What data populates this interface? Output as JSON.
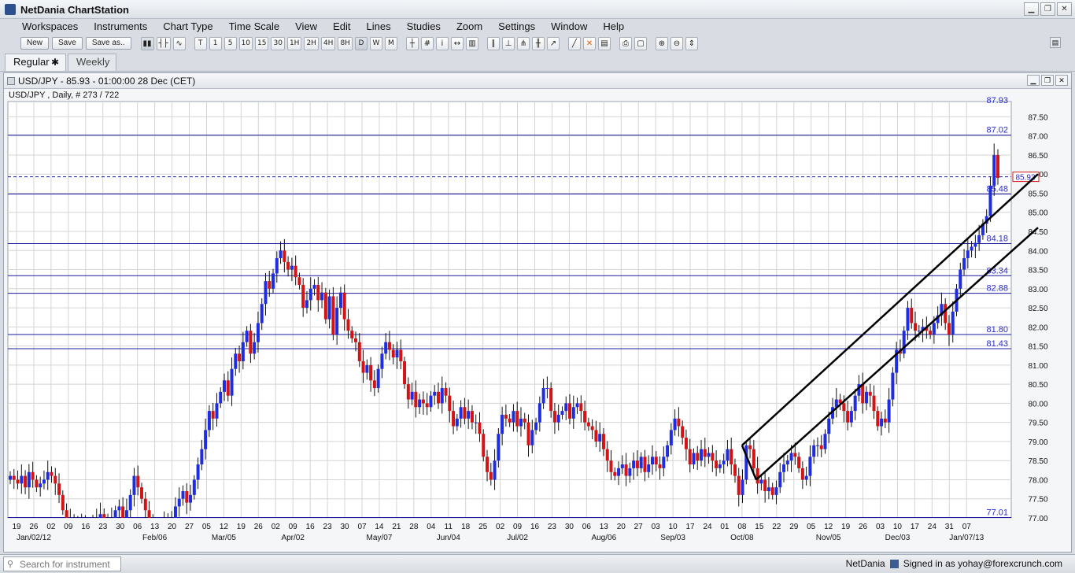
{
  "app": {
    "title": "NetDania ChartStation"
  },
  "menu": [
    "Workspaces",
    "Instruments",
    "Chart Type",
    "Time Scale",
    "View",
    "Edit",
    "Lines",
    "Studies",
    "Zoom",
    "Settings",
    "Window",
    "Help"
  ],
  "toolbar": {
    "new_label": "New",
    "save_label": "Save",
    "save_as_label": "Save as..",
    "timescale_buttons": [
      "T",
      "1",
      "5",
      "10",
      "15",
      "30",
      "1H",
      "2H",
      "4H",
      "8H",
      "D",
      "W",
      "M"
    ],
    "active_timescale": "D"
  },
  "tabs": [
    {
      "label": "Regular",
      "active": true
    },
    {
      "label": "Weekly",
      "active": false
    }
  ],
  "chart_window": {
    "title": "USD/JPY - 85.93 - 01:00:00  28 Dec (CET)",
    "subtitle": "USD/JPY , Daily, # 273 / 722"
  },
  "status": {
    "search_placeholder": "Search for instrument",
    "brand": "NetDania",
    "signed_in": "Signed in as yohay@forexcrunch.com"
  },
  "colors": {
    "up_candle": "#1f2de0",
    "down_candle": "#d21414",
    "hline": "#1a1aa0",
    "grid": "#d4d4d4",
    "price_label": "#2a2acc"
  },
  "chart_data": {
    "type": "candlestick",
    "instrument": "USD/JPY",
    "interval": "Daily",
    "ylim": [
      77.0,
      87.9
    ],
    "y_ticks": [
      77.0,
      77.5,
      78.0,
      78.5,
      79.0,
      79.5,
      80.0,
      80.5,
      81.0,
      81.5,
      82.0,
      82.5,
      83.0,
      83.5,
      84.0,
      84.5,
      85.0,
      85.5,
      86.0,
      86.5,
      87.0,
      87.5
    ],
    "y_tick_labels": [
      "77.00",
      "77.50",
      "78.00",
      "78.50",
      "79.00",
      "79.50",
      "80.00",
      "80.50",
      "81.00",
      "81.50",
      "82.00",
      "82.50",
      "83.00",
      "83.50",
      "84.00",
      "84.50",
      "85.00",
      "85.50",
      "86.00",
      "86.50",
      "87.00",
      "87.50"
    ],
    "x_tick_labels": [
      "19",
      "26",
      "02",
      "09",
      "16",
      "23",
      "30",
      "06",
      "13",
      "20",
      "27",
      "05",
      "12",
      "19",
      "26",
      "02",
      "09",
      "16",
      "23",
      "30",
      "07",
      "14",
      "21",
      "28",
      "04",
      "11",
      "18",
      "25",
      "02",
      "09",
      "16",
      "23",
      "30",
      "06",
      "13",
      "20",
      "27",
      "03",
      "10",
      "17",
      "24",
      "01",
      "08",
      "15",
      "22",
      "29",
      "05",
      "12",
      "19",
      "26",
      "03",
      "10",
      "17",
      "24",
      "31",
      "07"
    ],
    "x_month_labels": [
      "Jan/02/12",
      "Feb/06",
      "Mar/05",
      "Apr/02",
      "May/07",
      "Jun/04",
      "Jul/02",
      "Aug/06",
      "Sep/03",
      "Oct/08",
      "Nov/05",
      "Dec/03",
      "Jan/07/13"
    ],
    "horizontal_levels": [
      87.02,
      85.48,
      84.18,
      83.34,
      82.88,
      81.8,
      81.43,
      77.01
    ],
    "horizontal_level_labels": [
      "87.02",
      "85.48",
      "84.18",
      "83.34",
      "82.88",
      "81.80",
      "81.43",
      "77.01"
    ],
    "top_cut_label": "87.93",
    "last_price": 85.93,
    "last_price_label": "85.93",
    "channel": {
      "upper": [
        {
          "date": "Oct/08",
          "price": 78.9
        },
        {
          "date": "Jan/07/13",
          "price": 86.0
        }
      ],
      "lower": [
        {
          "date": "Oct/12",
          "price": 78.0
        },
        {
          "date": "Jan/07/13",
          "price": 84.6
        }
      ]
    },
    "closes": [
      78.1,
      78.0,
      77.9,
      78.1,
      77.8,
      78.2,
      78.0,
      77.8,
      77.9,
      78.0,
      78.2,
      78.1,
      77.9,
      77.6,
      77.2,
      77.0,
      76.8,
      76.7,
      76.9,
      76.6,
      76.8,
      76.7,
      76.9,
      77.0,
      77.1,
      76.8,
      76.9,
      77.0,
      77.2,
      77.3,
      76.9,
      77.2,
      77.6,
      78.1,
      77.8,
      77.5,
      77.2,
      76.8,
      76.6,
      76.7,
      76.8,
      76.9,
      77.0,
      76.9,
      77.3,
      77.5,
      77.7,
      77.4,
      77.6,
      78.0,
      78.4,
      78.8,
      79.3,
      79.8,
      79.6,
      80.0,
      80.3,
      80.6,
      80.2,
      80.9,
      81.3,
      81.1,
      81.6,
      81.9,
      81.3,
      81.6,
      82.1,
      82.6,
      83.2,
      83.0,
      83.4,
      83.8,
      84.0,
      83.7,
      83.5,
      83.6,
      83.3,
      83.1,
      82.5,
      82.7,
      83.0,
      83.1,
      82.7,
      82.9,
      82.2,
      82.8,
      81.8,
      82.5,
      82.9,
      82.2,
      81.9,
      81.7,
      81.6,
      81.1,
      80.8,
      81.0,
      80.6,
      80.4,
      80.9,
      81.3,
      81.6,
      81.4,
      81.2,
      81.4,
      81.1,
      80.5,
      80.1,
      80.3,
      79.9,
      80.1,
      80.0,
      79.9,
      80.2,
      80.3,
      80.0,
      80.4,
      80.2,
      79.8,
      79.4,
      79.6,
      79.9,
      79.6,
      79.8,
      79.5,
      79.5,
      79.2,
      78.6,
      78.2,
      78.0,
      78.5,
      79.2,
      79.7,
      79.6,
      79.5,
      79.8,
      79.4,
      79.6,
      79.5,
      78.9,
      79.3,
      79.5,
      80.0,
      80.4,
      80.4,
      79.8,
      79.5,
      79.7,
      79.8,
      80.0,
      79.6,
      79.9,
      80.0,
      79.8,
      79.5,
      79.4,
      79.3,
      79.0,
      79.2,
      78.8,
      78.5,
      78.2,
      78.1,
      78.3,
      78.4,
      78.1,
      78.3,
      78.5,
      78.3,
      78.6,
      78.2,
      78.4,
      78.6,
      78.4,
      78.3,
      78.6,
      78.9,
      79.3,
      79.6,
      79.4,
      79.1,
      78.8,
      78.4,
      78.7,
      78.5,
      78.8,
      78.6,
      78.7,
      78.5,
      78.3,
      78.4,
      78.5,
      78.8,
      78.4,
      78.1,
      77.6,
      78.0,
      78.9,
      78.8,
      78.3,
      77.9,
      78.0,
      77.7,
      77.8,
      77.6,
      77.8,
      78.2,
      78.4,
      78.5,
      78.7,
      78.6,
      78.3,
      78.0,
      78.1,
      78.6,
      78.9,
      78.9,
      78.8,
      79.2,
      79.6,
      79.9,
      80.1,
      80.0,
      79.8,
      79.5,
      79.8,
      80.2,
      80.5,
      80.0,
      80.3,
      80.2,
      79.8,
      79.4,
      79.6,
      79.5,
      80.1,
      80.8,
      81.4,
      81.3,
      81.9,
      82.5,
      82.1,
      81.9,
      81.9,
      82.0,
      81.9,
      81.8,
      82.1,
      82.3,
      82.6,
      82.1,
      81.8,
      82.4,
      83.0,
      83.5,
      83.8,
      84.0,
      84.1,
      84.2,
      84.4,
      84.7,
      84.9,
      85.7,
      86.5,
      85.9
    ]
  }
}
